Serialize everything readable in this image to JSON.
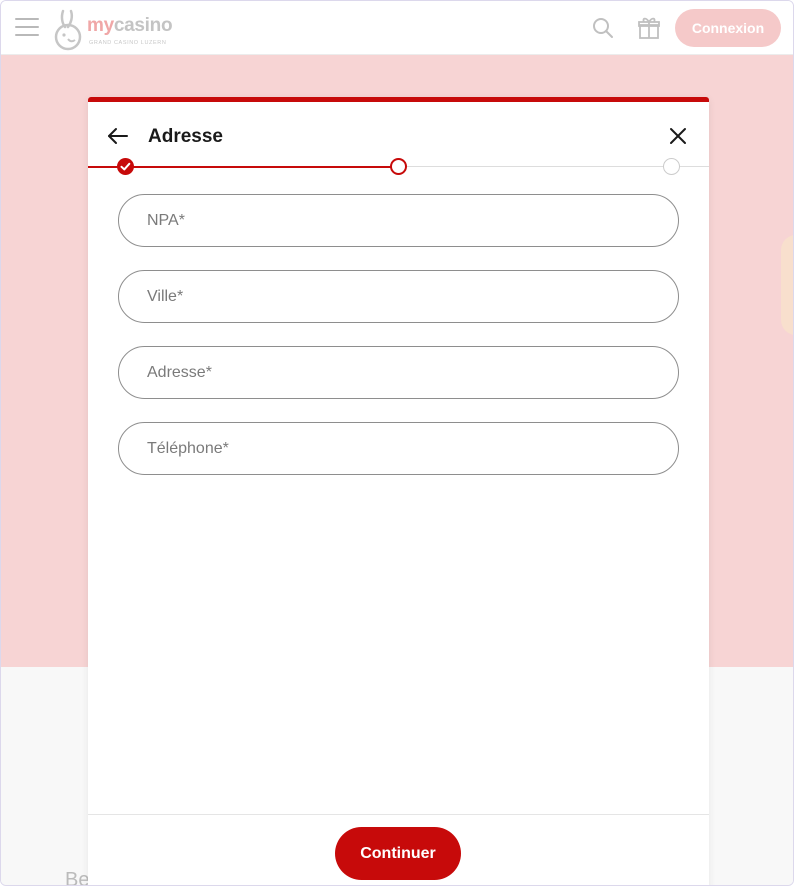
{
  "header": {
    "brand_my": "my",
    "brand_casino": "casino",
    "brand_subtitle": "GRAND CASINO LUZERN",
    "login_label": "Connexion",
    "icons": [
      "menu-icon",
      "search-icon",
      "gift-icon"
    ]
  },
  "background": {
    "partial_text": "Be"
  },
  "modal": {
    "title": "Adresse",
    "steps": [
      {
        "state": "done"
      },
      {
        "state": "current"
      },
      {
        "state": "upcoming"
      }
    ],
    "fields": [
      {
        "placeholder": "NPA*",
        "value": ""
      },
      {
        "placeholder": "Ville*",
        "value": ""
      },
      {
        "placeholder": "Adresse*",
        "value": ""
      },
      {
        "placeholder": "Téléphone*",
        "value": ""
      }
    ],
    "continue_label": "Continuer"
  },
  "colors": {
    "accent": "#c70a0a",
    "hero_bg": "#f7d4d4",
    "login_bg": "#f5c9c9"
  }
}
